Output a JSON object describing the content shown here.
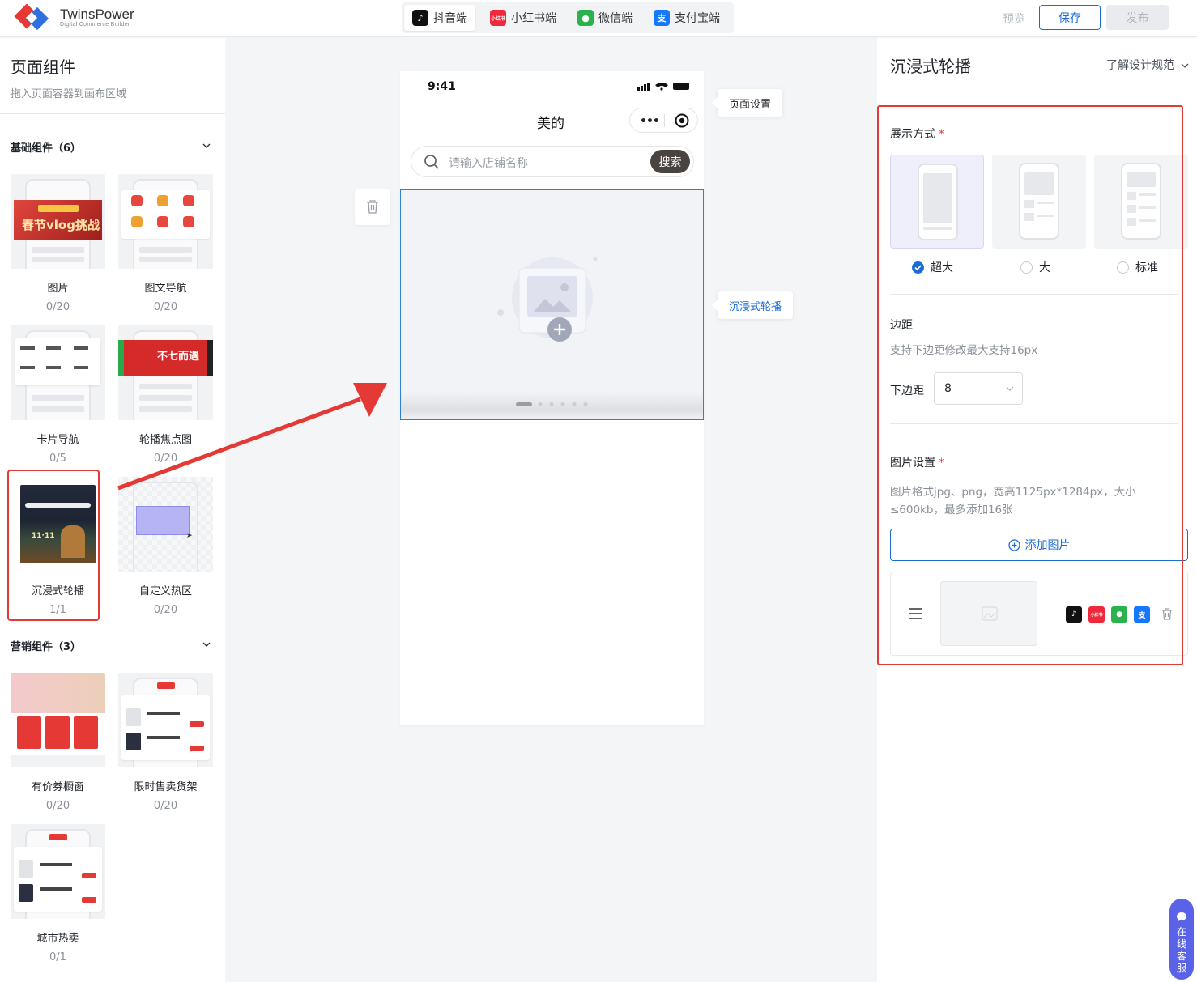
{
  "brand": {
    "name": "TwinsPower",
    "tagline": "Digital Commerce Builder"
  },
  "platform_tabs": [
    {
      "label": "抖音端",
      "icon": "douyin-icon",
      "active": true
    },
    {
      "label": "小红书端",
      "icon": "xiaohongshu-icon",
      "active": false
    },
    {
      "label": "微信端",
      "icon": "wechat-icon",
      "active": false
    },
    {
      "label": "支付宝端",
      "icon": "alipay-icon",
      "active": false
    }
  ],
  "toolbar": {
    "preview": "预览",
    "save": "保存",
    "publish": "发布"
  },
  "left_panel": {
    "title": "页面组件",
    "subtitle": "拖入页面容器到画布区域",
    "groups": [
      {
        "title": "基础组件（6）",
        "items": [
          {
            "name": "图片",
            "count": "0/20"
          },
          {
            "name": "图文导航",
            "count": "0/20"
          },
          {
            "name": "卡片导航",
            "count": "0/5"
          },
          {
            "name": "轮播焦点图",
            "count": "0/20"
          },
          {
            "name": "沉浸式轮播",
            "count": "1/1"
          },
          {
            "name": "自定义热区",
            "count": "0/20"
          }
        ]
      },
      {
        "title": "营销组件（3）",
        "items": [
          {
            "name": "有价券橱窗",
            "count": "0/20"
          },
          {
            "name": "限时售卖货架",
            "count": "0/20"
          },
          {
            "name": "城市热卖",
            "count": "0/1"
          }
        ]
      }
    ],
    "thumb_text": {
      "spring_banner": "春节vlog挑战",
      "promo_banner": "不七而遇",
      "immersive_date": "11·11"
    }
  },
  "phone": {
    "time": "9:41",
    "mini_program_title": "美的",
    "search_placeholder": "请输入店铺名称",
    "search_button": "搜索"
  },
  "canvas_tips": {
    "page_settings": "页面设置",
    "component": "沉浸式轮播"
  },
  "right_panel": {
    "title": "沉浸式轮播",
    "design_link": "了解设计规范",
    "display_mode": {
      "label": "展示方式",
      "options": [
        {
          "label": "超大",
          "selected": true
        },
        {
          "label": "大",
          "selected": false
        },
        {
          "label": "标准",
          "selected": false
        }
      ]
    },
    "margin": {
      "label": "边距",
      "hint": "支持下边距修改最大支持16px",
      "bottom_label": "下边距",
      "bottom_value": "8"
    },
    "image_settings": {
      "label": "图片设置",
      "hint_line1": "图片格式jpg、png，宽高1125px*1284px，大小",
      "hint_line2": "≤600kb，最多添加16张",
      "add_button": "添加图片"
    },
    "platform_badges": [
      "抖音",
      "小红书",
      "微信",
      "支付宝"
    ]
  },
  "service": {
    "label": "在线客服",
    "chars": [
      "在",
      "线",
      "客",
      "服"
    ]
  },
  "colors": {
    "accent": "#1a6bd8",
    "highlight": "#e53935",
    "service": "#5a63e8"
  }
}
